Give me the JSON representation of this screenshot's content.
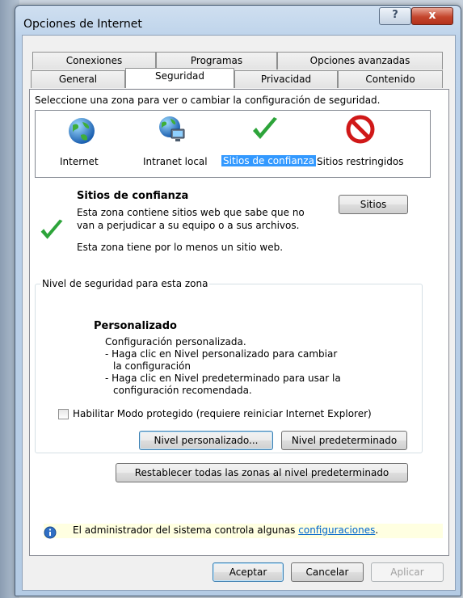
{
  "window": {
    "title": "Opciones de Internet",
    "help_glyph": "?",
    "close_glyph": "x"
  },
  "tabs": {
    "row_back": [
      "Conexiones",
      "Programas",
      "Opciones avanzadas"
    ],
    "row_front": [
      "General",
      "Seguridad",
      "Privacidad",
      "Contenido"
    ],
    "active": "Seguridad"
  },
  "security": {
    "zone_prompt": "Seleccione una zona para ver o cambiar la configuración de seguridad.",
    "zones": [
      {
        "label": "Internet",
        "icon": "globe-icon"
      },
      {
        "label": "Intranet local",
        "icon": "intranet-globe-icon"
      },
      {
        "label": "Sitios de confianza",
        "icon": "checkmark-icon",
        "selected": true
      },
      {
        "label": "Sitios restringidos",
        "icon": "no-entry-icon"
      }
    ],
    "zone_title": "Sitios de confianza",
    "zone_desc_1": "Esta zona contiene sitios web que sabe que no",
    "zone_desc_2": "van a perjudicar a su equipo o a sus archivos.",
    "zone_count": "Esta zona tiene por lo menos un sitio web.",
    "sites_button": "Sitios",
    "level_group_title": "Nivel de seguridad para esta zona",
    "level_name": "Personalizado",
    "level_lines": [
      "Configuración personalizada.",
      "- Haga clic en Nivel personalizado para cambiar",
      "la configuración",
      "- Haga clic en Nivel predeterminado para usar la",
      "configuración recomendada."
    ],
    "protected_mode_label": "Habilitar Modo protegido (requiere reiniciar Internet Explorer)",
    "protected_mode_checked": false,
    "custom_level_button": "Nivel personalizado...",
    "default_level_button": "Nivel predeterminado",
    "reset_all_button": "Restablecer todas las zonas al nivel predeterminado",
    "admin_notice": "El administrador del sistema controla algunas",
    "admin_link": "configuraciones",
    "admin_link_suffix": "."
  },
  "footer": {
    "ok": "Aceptar",
    "cancel": "Cancelar",
    "apply": "Aplicar"
  },
  "colors": {
    "selection": "#3399ff",
    "check_green": "#2da43a",
    "restricted_red": "#d01818",
    "info_bg": "#ffffe1"
  }
}
